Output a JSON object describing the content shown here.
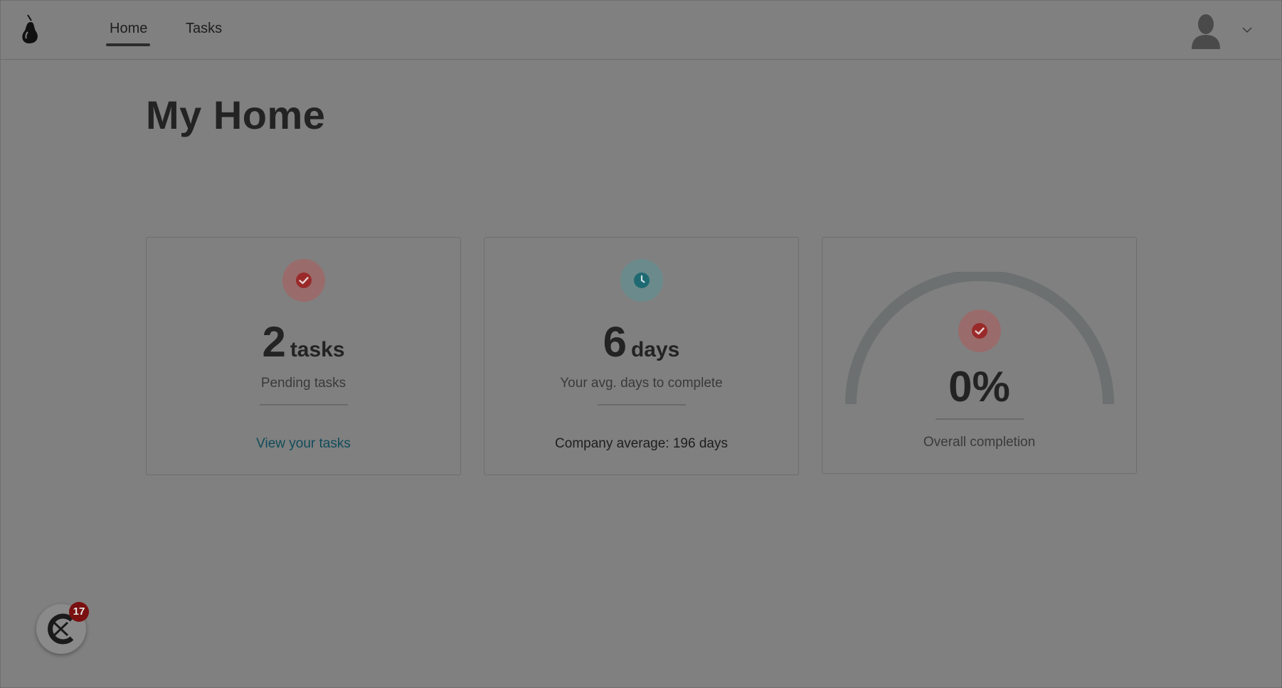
{
  "nav": {
    "tabs": [
      {
        "label": "Home",
        "active": true
      },
      {
        "label": "Tasks",
        "active": false
      }
    ]
  },
  "page": {
    "title": "My Home"
  },
  "cards": {
    "pending": {
      "icon": "check-circle-icon",
      "value": "2",
      "unit": "tasks",
      "subtitle": "Pending tasks",
      "link_label": "View your tasks"
    },
    "avg_days": {
      "icon": "clock-icon",
      "value": "6",
      "unit": "days",
      "subtitle": "Your avg. days to complete",
      "company_average": "Company average:  196 days"
    },
    "completion": {
      "icon": "check-circle-icon",
      "value": "0%",
      "progress": 0,
      "label": "Overall completion"
    }
  },
  "widget": {
    "badge_count": "17"
  },
  "colors": {
    "accent_red": "#9a2a2a",
    "accent_teal": "#1f6a72",
    "link": "#104c5a"
  }
}
